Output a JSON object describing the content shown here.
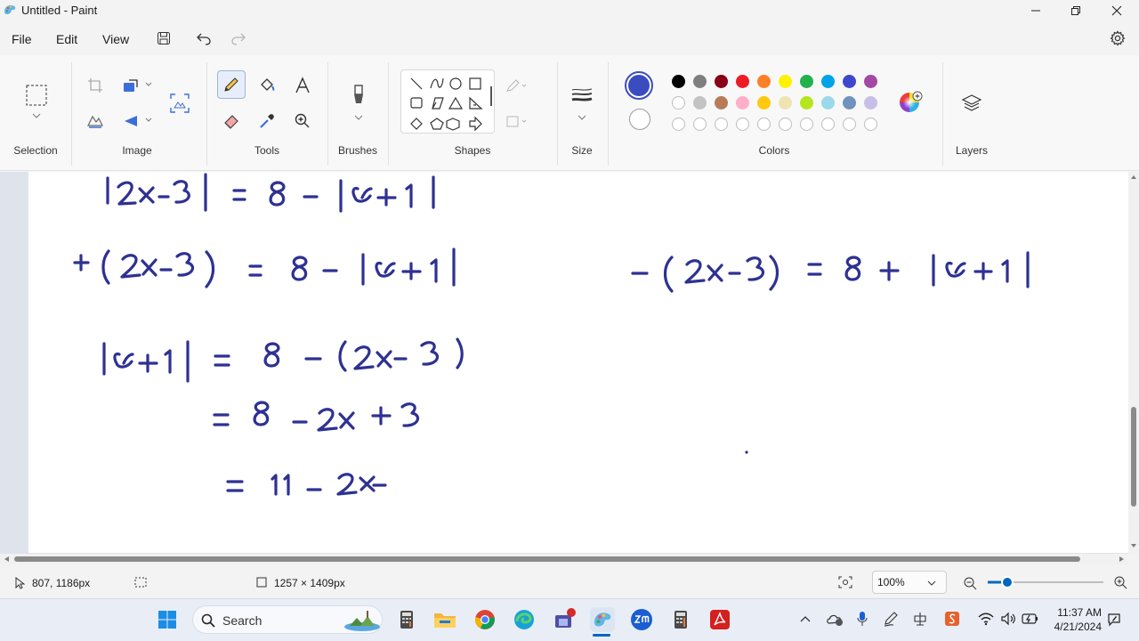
{
  "window": {
    "title": "Untitled - Paint"
  },
  "menu": {
    "file": "File",
    "edit": "Edit",
    "view": "View"
  },
  "ribbon": {
    "groups": {
      "selection": "Selection",
      "image": "Image",
      "tools": "Tools",
      "brushes": "Brushes",
      "shapes": "Shapes",
      "size": "Size",
      "colors": "Colors",
      "layers": "Layers"
    },
    "primary_color": "#3b4cc0",
    "secondary_color": "#ffffff",
    "palette_row1": [
      "#000000",
      "#7f7f7f",
      "#880015",
      "#ed1c24",
      "#ff7f27",
      "#fff200",
      "#22b14c",
      "#00a2e8",
      "#3f48cc",
      "#a349a4"
    ],
    "palette_row2": [
      "#ffffff",
      "#c3c3c3",
      "#b97a57",
      "#ffaec9",
      "#ffc90e",
      "#efe4b0",
      "#b5e61d",
      "#99d9ea",
      "#7092be",
      "#c8bfe7"
    ]
  },
  "canvas": {
    "ink_color": "#2e3192",
    "handwriting": {
      "line1": "|2x-3| = 8 - |x+1|",
      "line2_left": "+(2x-3) = 8 - |x+1|",
      "line2_right": "-(2x-3) = 8 + |x+1|",
      "line3": "|x+1| = 8 - (2x-3)",
      "line4": "= 8 - 2x + 3",
      "line5": "= 11 - 2x"
    }
  },
  "status": {
    "cursor_position": "807, 1186px",
    "canvas_size": "1257 × 1409px",
    "zoom": "100%",
    "zoom_fraction": 0.25
  },
  "taskbar": {
    "search_label": "Search",
    "time": "11:37 AM",
    "date": "4/21/2024"
  }
}
